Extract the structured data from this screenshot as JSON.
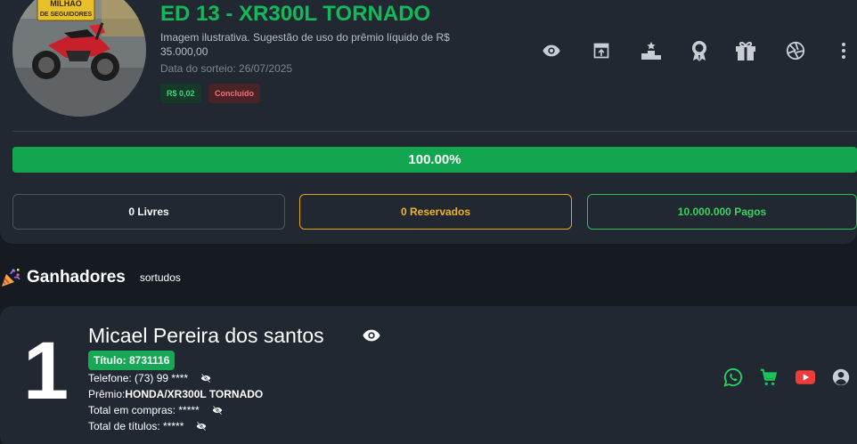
{
  "raffle": {
    "title": "ED 13 - XR300L TORNADO",
    "description": "Imagem ilustrativa. Sugestão de uso do prêmio líquido de R$ 35.000,00",
    "draw_date": "Data do sorteio: 26/07/2025",
    "price_badge": "R$ 0,02",
    "status_badge": "Concluído",
    "image_text_line1": "MILHÃO",
    "image_text_line2": "DE SEGUIDORES"
  },
  "actions": [
    {
      "name": "eye-icon"
    },
    {
      "name": "share-icon"
    },
    {
      "name": "podium-icon"
    },
    {
      "name": "award-icon"
    },
    {
      "name": "gift-icon"
    },
    {
      "name": "aperture-icon"
    },
    {
      "name": "more-vertical-icon"
    }
  ],
  "progress": {
    "value": 1.0,
    "label": "100.00%"
  },
  "stats": {
    "free": "0 Livres",
    "reserved": "0 Reservados",
    "paid": "10.000.000 Pagos"
  },
  "winners_section": {
    "title": "Ganhadores",
    "subtitle": "sortudos"
  },
  "winner": {
    "place": "1",
    "name": "Micael Pereira dos santos",
    "ticket": "Título: 8731116",
    "phone": "Telefone: (73) 99 ****",
    "prize_label": "Prêmio: ",
    "prize_value": "HONDA/XR300L TORNADO",
    "total_purchases": "Total em compras: *****",
    "total_titles": "Total de títulos: *****"
  },
  "colors": {
    "accent_green": "#14b85a",
    "reserved_orange": "#f0b323",
    "whatsapp": "#25d366",
    "cart": "#19c25a",
    "youtube": "#ef3b3b"
  }
}
